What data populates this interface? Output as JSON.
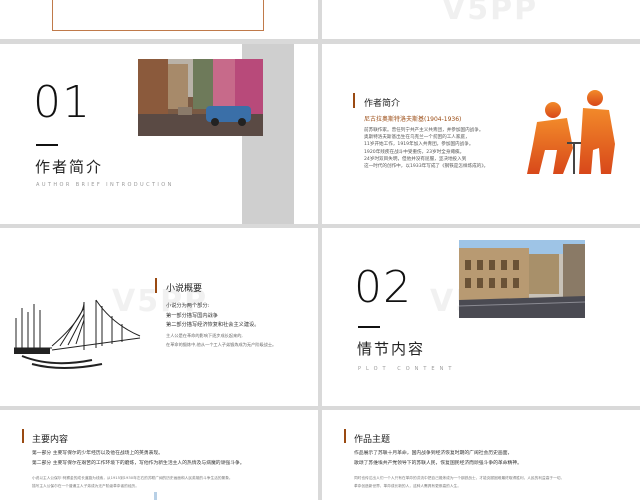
{
  "slide_top": {
    "watermark": "V5PP"
  },
  "slide_author_title": {
    "number": "01",
    "title": "作者简介",
    "subtitle": "AUTHOR BRIEF INTRODUCTION"
  },
  "slide_author_body": {
    "heading": "作者简介",
    "name": "尼古拉奥斯特洛夫斯基(1904-1936)",
    "lines": [
      "前苏联作家。曾任列宁共产主义共青团，并参加国内战争。",
      "奥斯特洛夫斯基出生在乌克兰一个贫困的工人家庭，",
      "11岁开始工作，1919年加入共青团，参加国内战争。",
      "1920年残疾在战斗中受重伤，23岁时全身瘫痪。",
      "24岁时双目失明，但他并没有屈服，坚决地投入到",
      "这一时代的创作中，以1933年写成了《钢铁是怎样炼成的》。"
    ]
  },
  "slide_summary": {
    "heading": "小说概要",
    "lines": [
      "小说分为两个部分:",
      "第一部分描写国内战争",
      "第二部分描写经济恢复和社会主义建设。",
      "主人公是在革命的影响下逐步成长起来的,",
      "在革命的锻炼中,他从一个工人子弟锻炼成为无产阶级战士。"
    ],
    "watermark": "V5PP"
  },
  "slide_plot_title": {
    "number": "02",
    "title": "情节内容",
    "subtitle": "PLOT CONTENT",
    "watermark": "V5PP"
  },
  "slide_main": {
    "heading": "主要内容",
    "lines": [
      "第一部分 主要写保尔的少年经历以及他在战场上的英勇表现。",
      "第二部分 主要写保尔在艰苦的工作环境下的磨炼，写他作为新生活主人的热情及与病魔的顽强斗争。"
    ],
    "small_lines": [
      "小说以主人公保尔·柯察金的成长道路为线索，从1915到1930年左右的苏联广阔的历史画面和人民英雄的斗争生活的景象。",
      "描写主人公保尔在一个普通主人子弟成为无产阶级革命者的经历。"
    ]
  },
  "slide_theme": {
    "heading": "作品主题",
    "lines": [
      "作品展示了苏联十月革命，国内战争到经济恢复时期的广阔社会历史画面，",
      "歌颂了苏维埃共产党领导下的苏联人民，恢复国民经济而顽强斗争的革命精神。"
    ],
    "small_lines": [
      "同时也传达出人们一个人只有在革命的洪流中把自己锻炼成为一个钢铁战士，才能克服困难最终取得胜利，人民的利益高于一切。",
      "革命创造新世界，革命成长新的人，这种人需具有更崇高的人生。"
    ]
  },
  "colors": {
    "accent": "#9a4a12",
    "orange_silhouette": "#e8661a",
    "grey_bar": "#cfcfcf",
    "frame": "#c07a4a"
  }
}
